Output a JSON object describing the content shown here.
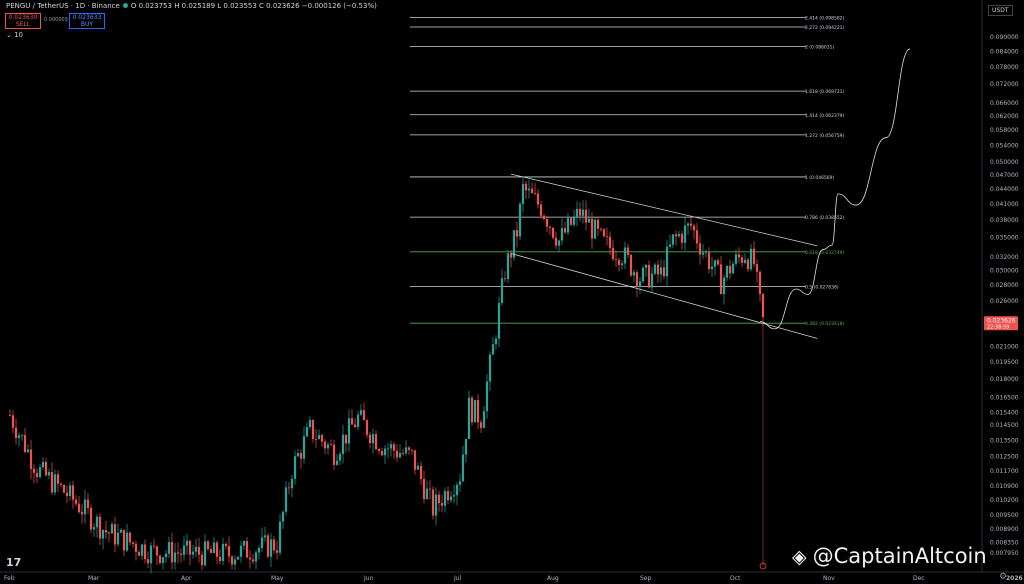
{
  "header": {
    "symbol": "PENGU / TetherUS · 1D · Binance",
    "ohlc": "O 0.023753 H 0.025189 L 0.023553 C 0.023626 −0.000126 (−0.53%)",
    "sell_price": "0.023630",
    "sell_label": "SELL",
    "spread": "0.000003",
    "buy_price": "0.023633",
    "buy_label": "BUY",
    "indicator_count": "10",
    "currency": "USDT",
    "watermark": "@CaptainAltcoin",
    "tv_logo": "17"
  },
  "colors": {
    "up": "#26a69a",
    "down": "#ef5350",
    "fib_green": "#4caf50",
    "fib_line": "#d1d4dc",
    "bg": "#000000"
  },
  "chart_data": {
    "type": "candlestick",
    "y_scale": "log",
    "ylim": [
      0.00795,
      0.1045
    ],
    "x_labels": [
      "Feb",
      "Mar",
      "Apr",
      "May",
      "Jun",
      "Jul",
      "Aug",
      "Sep",
      "Oct",
      "Nov",
      "Dec",
      "2026"
    ],
    "y_ticks": [
      "0.090000",
      "0.084000",
      "0.078000",
      "0.072000",
      "0.066000",
      "0.062000",
      "0.058000",
      "0.054000",
      "0.050000",
      "0.047000",
      "0.044000",
      "0.041000",
      "0.038000",
      "0.035000",
      "0.032000",
      "0.030000",
      "0.028000",
      "0.026000",
      "0.023626",
      "0.021000",
      "0.019500",
      "0.018000",
      "0.016500",
      "0.015400",
      "0.014500",
      "0.013500",
      "0.012500",
      "0.011700",
      "0.010900",
      "0.010200",
      "0.009500",
      "0.008900",
      "0.008350",
      "0.007950"
    ],
    "last_price": "0.023626",
    "last_price_countdown": "22:38:59",
    "fib_levels": [
      {
        "label": "2.414 (0.098582)",
        "value": 0.098582
      },
      {
        "label": "2.272 (0.094221)",
        "value": 0.094221
      },
      {
        "label": "2 (0.086031)",
        "value": 0.086031
      },
      {
        "label": "1.618 (0.069721)",
        "value": 0.069721
      },
      {
        "label": "1.414 (0.062379)",
        "value": 0.062379
      },
      {
        "label": "1.272 (0.056759)",
        "value": 0.056759
      },
      {
        "label": "1 (0.046569)",
        "value": 0.046569
      },
      {
        "label": "0.786 (0.038552)",
        "value": 0.038552
      },
      {
        "label": "0.618 (0.032749)",
        "value": 0.032749,
        "highlight": true
      },
      {
        "label": "0.5 (0.027838)",
        "value": 0.027838
      },
      {
        "label": "0.382 (0.023418)",
        "value": 0.023418,
        "highlight": true
      }
    ],
    "channel": {
      "upper": {
        "from": [
          "2025-07-18",
          0.0472
        ],
        "to": [
          "2025-10-28",
          0.0337
        ]
      },
      "lower": {
        "from": [
          "2025-07-18",
          0.0325
        ],
        "to": [
          "2025-10-28",
          0.0218
        ]
      }
    },
    "projection": [
      [
        "2025-10-09",
        0.0236
      ],
      [
        "2025-10-14",
        0.0228
      ],
      [
        "2025-10-21",
        0.0275
      ],
      [
        "2025-10-25",
        0.0268
      ],
      [
        "2025-10-30",
        0.0331
      ],
      [
        "2025-11-02",
        0.0338
      ],
      [
        "2025-11-04",
        0.043
      ],
      [
        "2025-11-10",
        0.0408
      ],
      [
        "2025-11-20",
        0.056
      ],
      [
        "2025-11-28",
        0.085
      ]
    ],
    "candles": [
      [
        0.0128,
        0.0138,
        0.012,
        0.0126
      ],
      [
        0.0126,
        0.013,
        0.0116,
        0.0118
      ],
      [
        0.0118,
        0.0128,
        0.0112,
        0.0124
      ],
      [
        0.0124,
        0.0126,
        0.0108,
        0.011
      ],
      [
        0.011,
        0.0118,
        0.0102,
        0.0105
      ],
      [
        0.0105,
        0.0112,
        0.0098,
        0.01
      ],
      [
        0.01,
        0.0106,
        0.0094,
        0.0097
      ],
      [
        0.0097,
        0.011,
        0.0095,
        0.0108
      ],
      [
        0.0108,
        0.0112,
        0.0098,
        0.0101
      ],
      [
        0.0101,
        0.0104,
        0.0092,
        0.0094
      ],
      [
        0.0094,
        0.0102,
        0.009,
        0.0099
      ],
      [
        0.0099,
        0.0103,
        0.0088,
        0.009
      ],
      [
        0.009,
        0.0096,
        0.0084,
        0.0086
      ],
      [
        0.0086,
        0.0094,
        0.0083,
        0.0092
      ],
      [
        0.0092,
        0.0098,
        0.0086,
        0.0088
      ],
      [
        0.0088,
        0.0091,
        0.008,
        0.0082
      ],
      [
        0.0082,
        0.0087,
        0.0079,
        0.0085
      ],
      [
        0.0085,
        0.0095,
        0.0083,
        0.0093
      ],
      [
        0.0093,
        0.01,
        0.0087,
        0.0089
      ],
      [
        0.0089,
        0.0093,
        0.008,
        0.0081
      ]
    ]
  }
}
